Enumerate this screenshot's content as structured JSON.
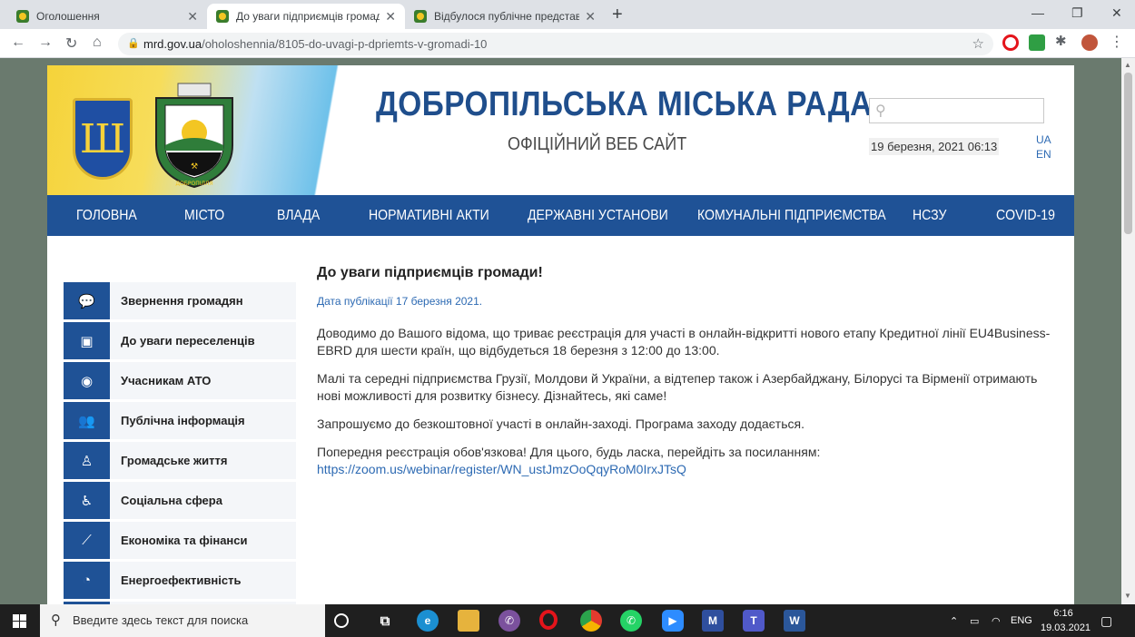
{
  "browser": {
    "tabs": [
      {
        "title": "Оголошення",
        "active": false
      },
      {
        "title": "До уваги підприємців громади!",
        "active": true
      },
      {
        "title": "Відбулося публічне представлення",
        "active": false
      }
    ],
    "url_host": "mrd.gov.ua",
    "url_path": "/oholoshennia/8105-do-uvagi-p-dpriemts-v-gromadi-10"
  },
  "header": {
    "title": "ДОБРОПІЛЬСЬКА МІСЬКА РАДА",
    "subtitle": "ОФІЦІЙНИЙ ВЕБ САЙТ",
    "search_placeholder": "",
    "date": "19 березня, 2021 06:13",
    "lang_ua": "UA",
    "lang_en": "EN",
    "emblem_text": "ДОБРОПІЛЛЯ"
  },
  "menu": [
    "ГОЛОВНА",
    "МІСТО",
    "ВЛАДА",
    "НОРМАТИВНІ АКТИ",
    "ДЕРЖАВНІ УСТАНОВИ",
    "КОМУНАЛЬНІ ПІДПРИЄМСТВА",
    "НСЗУ",
    "COVID-19"
  ],
  "sidebar": [
    {
      "label": "Звернення громадян",
      "icon": "chat-icon"
    },
    {
      "label": "До уваги переселенців",
      "icon": "bus-icon"
    },
    {
      "label": "Учасникам АТО",
      "icon": "target-icon"
    },
    {
      "label": "Публічна інформація",
      "icon": "users-icon"
    },
    {
      "label": "Громадське життя",
      "icon": "person-icon"
    },
    {
      "label": "Соціальна сфера",
      "icon": "accessibility-icon"
    },
    {
      "label": "Економіка та фінанси",
      "icon": "chart-icon"
    },
    {
      "label": "Енергоефективність",
      "icon": "gauge-icon"
    }
  ],
  "article": {
    "title": "До уваги підприємців громади!",
    "published": "Дата публікації 17 березня 2021.",
    "p1": "Доводимо до Вашого відома, що триває реєстрація для участі  в онлайн-відкритті нового етапу Кредитної лінії EU4Business-EBRD для шести країн, що відбудеться 18 березня з 12:00 до 13:00.",
    "p2": "Малі та середні підприємства Грузії, Молдови й України, а відтепер також і Азербайджану, Білорусі та Вірменії отримають нові можливості для розвитку бізнесу. Дізнайтесь, які саме!",
    "p3": "Запрошуємо до безкоштовної участі в онлайн-заході. Програма заходу додається.",
    "p4": "Попередня реєстрація обов'язкова! Для цього, будь ласка, перейдіть за посиланням:",
    "link": "https://zoom.us/webinar/register/WN_ustJmzOoQqyRoM0IrxJTsQ"
  },
  "taskbar": {
    "search_placeholder": "Введите здесь текст для поиска",
    "lang": "ENG",
    "time": "6:16",
    "date": "19.03.2021"
  }
}
